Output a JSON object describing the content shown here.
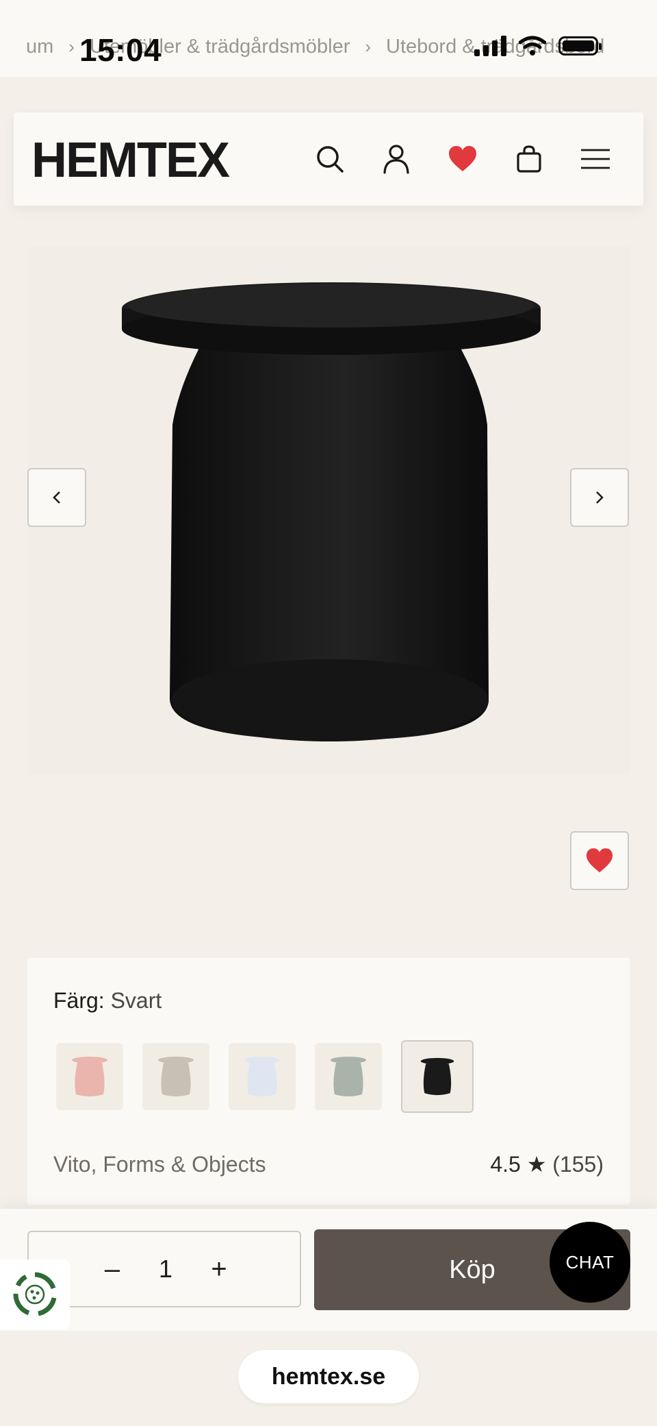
{
  "status_bar": {
    "time": "15:04"
  },
  "breadcrumb": [
    "um",
    "Utemöbler & trädgårdsmöbler",
    "Utebord & trädgårdsbord"
  ],
  "header": {
    "logo": "HEMTEX"
  },
  "color_selector": {
    "label": "Färg:",
    "value": "Svart",
    "swatches": [
      {
        "name": "Rosa",
        "color": "#eab5ac"
      },
      {
        "name": "Beige",
        "color": "#c8c0b4"
      },
      {
        "name": "Ljusblå",
        "color": "#dfe6f2"
      },
      {
        "name": "Grön",
        "color": "#a9b3aa"
      },
      {
        "name": "Svart",
        "color": "#1a1a1a",
        "selected": true
      }
    ]
  },
  "product": {
    "brand": "Vito, Forms & Objects",
    "rating": "4.5",
    "rating_star": "★",
    "review_count": "(155)"
  },
  "buy_bar": {
    "quantity": "1",
    "minus_label": "–",
    "plus_label": "+",
    "buy_label": "Köp"
  },
  "chat": {
    "label": "CHAT"
  },
  "browser": {
    "url": "hemtex.se"
  },
  "colors": {
    "background": "#f4f0e9",
    "card": "#fbf9f5",
    "buy_button": "#5b534c",
    "heart": "#e0393e"
  },
  "icons": [
    "search-icon",
    "user-icon",
    "heart-icon",
    "bag-icon",
    "menu-icon",
    "chevron-left-icon",
    "chevron-right-icon",
    "eco-badge-icon"
  ]
}
